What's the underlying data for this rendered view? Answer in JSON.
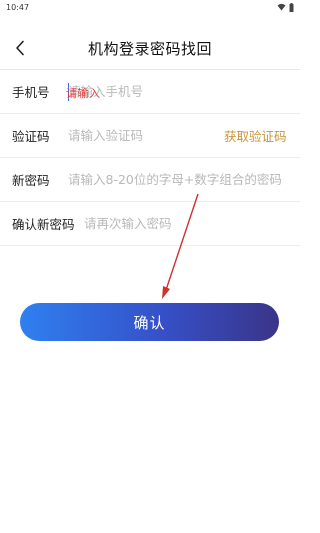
{
  "status": {
    "time": "10:47"
  },
  "header": {
    "title": "机构登录密码找回"
  },
  "form": {
    "phone": {
      "label": "手机号",
      "placeholder": "请输入手机号",
      "overlay": "请输入"
    },
    "code": {
      "label": "验证码",
      "placeholder": "请输入验证码",
      "action": "获取验证码"
    },
    "new_password": {
      "label": "新密码",
      "placeholder": "请输入8-20位的字母+数字组合的密码"
    },
    "confirm_password": {
      "label": "确认新密码",
      "placeholder": "请再次输入密码"
    }
  },
  "confirm_button": {
    "label": "确认"
  },
  "colors": {
    "accent_gold": "#c8943a",
    "button_start": "#2f80f0",
    "button_end": "#3a3488",
    "annotation_red": "#e23a3a"
  },
  "icons": [
    "back-arrow-icon",
    "wifi-icon",
    "battery-icon"
  ]
}
